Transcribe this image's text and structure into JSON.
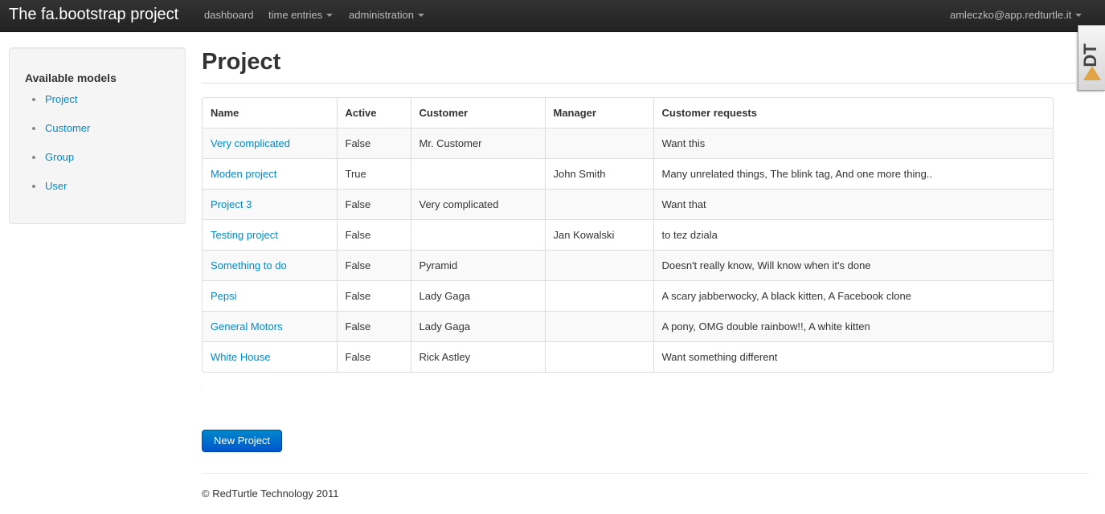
{
  "navbar": {
    "brand": "The fa.bootstrap project",
    "items": [
      {
        "label": "dashboard"
      },
      {
        "label": "time entries"
      },
      {
        "label": "administration"
      }
    ],
    "user": "amleczko@app.redturtle.it"
  },
  "debug_toolbar": {
    "label": "DT"
  },
  "sidebar": {
    "title": "Available models",
    "items": [
      {
        "label": "Project"
      },
      {
        "label": "Customer"
      },
      {
        "label": "Group"
      },
      {
        "label": "User"
      }
    ]
  },
  "main": {
    "title": "Project",
    "table": {
      "headers": [
        "Name",
        "Active",
        "Customer",
        "Manager",
        "Customer requests"
      ],
      "rows": [
        [
          "Very complicated",
          "False",
          "Mr. Customer",
          "",
          "Want this"
        ],
        [
          "Moden project",
          "True",
          "",
          "John Smith",
          "Many unrelated things, The blink tag, And one more thing.."
        ],
        [
          "Project 3",
          "False",
          "Very complicated",
          "",
          "Want that"
        ],
        [
          "Testing project",
          "False",
          "",
          "Jan Kowalski",
          "to tez dziala"
        ],
        [
          "Something to do",
          "False",
          "Pyramid",
          "",
          "Doesn't really know, Will know when it's done"
        ],
        [
          "Pepsi",
          "False",
          "Lady Gaga",
          "",
          "A scary jabberwocky, A black kitten, A Facebook clone"
        ],
        [
          "General Motors",
          "False",
          "Lady Gaga",
          "",
          "A pony, OMG double rainbow!!, A white kitten"
        ],
        [
          "White House",
          "False",
          "Rick Astley",
          "",
          "Want something different"
        ]
      ]
    },
    "new_button": "New Project"
  },
  "footer": {
    "text": "© RedTurtle Technology 2011"
  }
}
